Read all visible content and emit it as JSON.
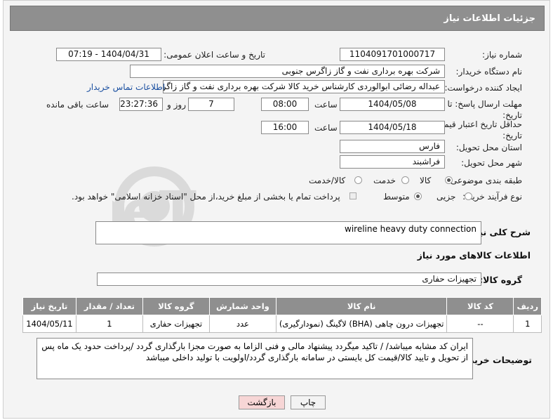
{
  "header": {
    "title": "جزئیات اطلاعات نیاز"
  },
  "fields": {
    "need_number_label": "شماره نیاز:",
    "need_number": "1104091701000717",
    "announce_label": "تاریخ و ساعت اعلان عمومی:",
    "announce_value": "1404/04/31 - 07:19",
    "buyer_org_label": "نام دستگاه خریدار:",
    "buyer_org": "شرکت بهره برداری نفت و گاز زاگرس جنوبی",
    "requester_label": "ایجاد کننده درخواست:",
    "requester": "عبداله رضائی ابوالوردی کارشناس خرید کالا شرکت بهره برداری نفت و گاز زاگرس",
    "contact_link": "اطلاعات تماس خریدار",
    "deadline_label": "مهلت ارسال پاسخ: تا تاریخ:",
    "deadline_date": "1404/05/08",
    "time_label": "ساعت",
    "deadline_time": "08:00",
    "days_value": "7",
    "days_label": "روز و",
    "remaining_time": "23:27:36",
    "remaining_label": "ساعت باقی مانده",
    "price_label": "حداقل تاریخ اعتبار قیمت: تا تاریخ:",
    "price_date": "1404/05/18",
    "price_time_label": "ساعت",
    "price_time": "16:00",
    "province_label": "استان محل تحویل:",
    "province": "فارس",
    "city_label": "شهر محل تحویل:",
    "city": "فراشبند",
    "category_label": "طبقه بندی موضوعی:",
    "category_options": [
      "کالا",
      "خدمت",
      "کالا/خدمت"
    ],
    "process_label": "نوع فرآیند خرید :",
    "process_options": [
      "جزیی",
      "متوسط"
    ],
    "payment_note": "پرداخت تمام یا بخشی از مبلغ خرید،از محل \"اسناد خزانه اسلامی\" خواهد بود."
  },
  "summary": {
    "label": "شرح کلی نیاز:",
    "value": "wireline heavy duty connection"
  },
  "goods_section": {
    "title": "اطلاعات کالاهای مورد نیاز"
  },
  "goods_group": {
    "label": "گروه کالا:",
    "value": "تجهیزات حفاری"
  },
  "table": {
    "headers": [
      "ردیف",
      "کد کالا",
      "نام کالا",
      "واحد شمارش",
      "گروه کالا",
      "تعداد / مقدار",
      "تاریخ نیاز"
    ],
    "rows": [
      [
        "1",
        "--",
        "تجهیزات درون چاهی (BHA) لاگینگ (نمودارگیری)",
        "عدد",
        "تجهیزات حفاری",
        "1",
        "1404/05/11"
      ]
    ]
  },
  "buyer_notes": {
    "label": "توضیحات خریدار:",
    "value": "ایران کد مشابه میباشد/ / تاکید میگردد پیشنهاد مالی و فنی الزاما به صورت مجزا بارگذاری گردد /پرداخت حدود یک ماه پس از تحویل و تایید کالا/قیمت کل بایستی در سامانه بارگذاری گردد/اولویت با تولید داخلی میباشد"
  },
  "buttons": {
    "print": "چاپ",
    "back": "بازگشت"
  },
  "watermark": {
    "text": "AriaTender.neT"
  },
  "colors": {
    "header_bg": "#8f8f8f",
    "link": "#1a4fa0",
    "back_btn_bg": "#f7d6d6"
  }
}
